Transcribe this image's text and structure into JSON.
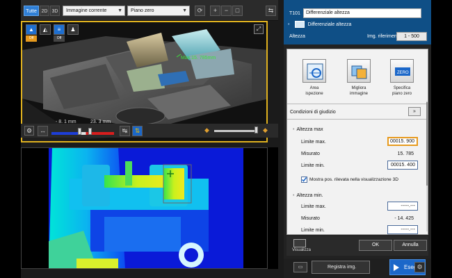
{
  "toolbar": {
    "tabs": [
      {
        "label": "Tutte",
        "active": true
      },
      {
        "label": "2D",
        "active": false
      },
      {
        "label": "3D",
        "active": false
      }
    ],
    "image_select": "Immagine corrente",
    "plane_select": "Piano zero"
  },
  "view3d": {
    "measurement_label": "Max:15. 785mm",
    "range_low_label": "- 8. 1  mm",
    "range_high_label": "23. 3  mm",
    "mode_buttons": [
      "Off",
      "Off"
    ]
  },
  "tool": {
    "code": "T101",
    "name": "Differenziale altezza",
    "type_label": "Differenziale altezza",
    "section_label": "Altezza",
    "reference_label": "Img. riferimento",
    "reference_value": "1 - 500"
  },
  "actions": [
    {
      "label": "Area\nispezione"
    },
    {
      "label": "Migliora\nimmagine"
    },
    {
      "label": "Specifica\npiano zero"
    }
  ],
  "conditions": {
    "title": "Condizioni di giudizio",
    "next_label": "»",
    "max_height": {
      "title": "Altezza max",
      "limit_max_label": "Limite max.",
      "limit_max_value": "00015. 900",
      "measured_label": "Misurato",
      "measured_value": "15. 785",
      "limit_min_label": "Limite min.",
      "limit_min_value": "00015. 400"
    },
    "show_position_label": "Mostra pos. rilevata nella visualizzazione 3D",
    "show_position_checked": true,
    "min_height": {
      "title": "Altezza min.",
      "limit_max_label": "Limite max.",
      "limit_max_value": "-----.---",
      "measured_label": "Misurato",
      "measured_value": "- 14. 425",
      "limit_min_label": "Limite min.",
      "limit_min_value": "-----.---"
    }
  },
  "footer": {
    "visualize_label": "Visualizza",
    "ok_label": "OK",
    "cancel_label": "Annulla"
  },
  "bottom": {
    "register_label": "Registra img.",
    "execute_label": "Esegui"
  },
  "colors": {
    "accent_blue": "#1b67c9",
    "highlight_orange": "#e79a1e",
    "view_border": "#e0b21f",
    "measure_green": "#3ce23c"
  }
}
